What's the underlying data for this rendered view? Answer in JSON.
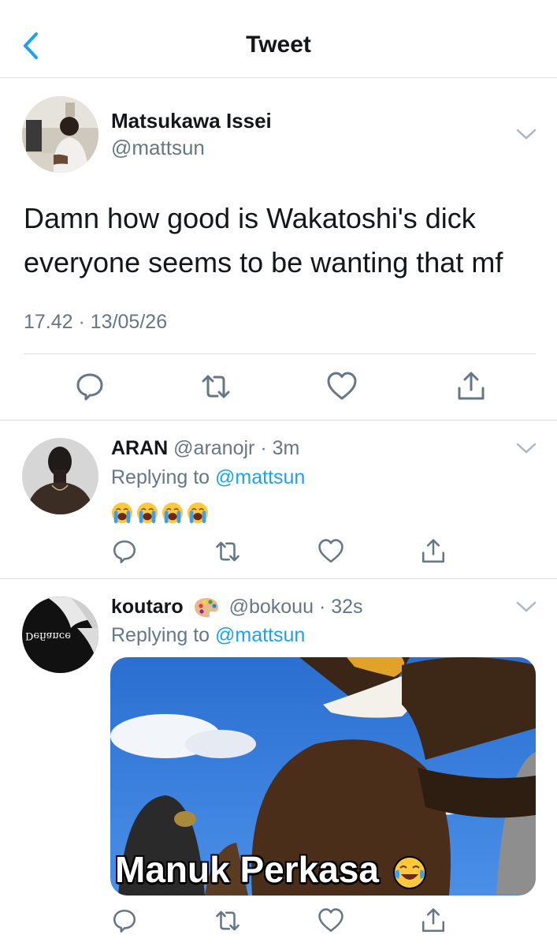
{
  "header": {
    "title": "Tweet",
    "back_icon": "chevron-left-icon"
  },
  "main_tweet": {
    "display_name": "Matsukawa Issei",
    "handle": "@mattsun",
    "text": "Damn how good is Wakatoshi's dick everyone seems to be wanting that mf",
    "timestamp": "17.42 · 13/05/26"
  },
  "replies": [
    {
      "display_name": "ARAN",
      "handle": "@aranojr",
      "sep": "·",
      "time": "3m",
      "replying_prefix": "Replying to",
      "replying_to": "@mattsun",
      "emojis": [
        "loudly-crying-face",
        "loudly-crying-face",
        "loudly-crying-face",
        "loudly-crying-face"
      ]
    },
    {
      "display_name": "koutaro",
      "name_emoji": "artist-palette",
      "handle": "@bokouu",
      "sep": "·",
      "time": "32s",
      "replying_prefix": "Replying to",
      "replying_to": "@mattsun",
      "media_caption": "Manuk Perkasa",
      "avatar_text": "Defiance"
    }
  ],
  "actions": [
    "reply-icon",
    "retweet-icon",
    "like-icon",
    "share-icon"
  ],
  "colors": {
    "accent": "#1da1f2",
    "secondary_text": "#657786",
    "divider": "#dcdfe2"
  }
}
